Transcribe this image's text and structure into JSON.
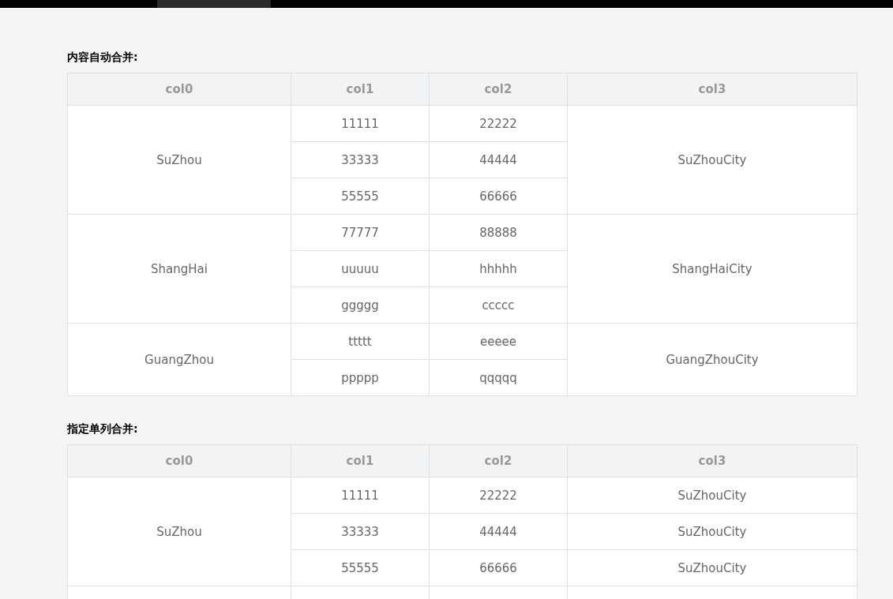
{
  "tables": [
    {
      "title": "内容自动合并:",
      "merge_col3": true,
      "columns": [
        "col0",
        "col1",
        "col2",
        "col3"
      ],
      "groups": [
        {
          "col0": "SuZhou",
          "col3": "SuZhouCity",
          "rows": [
            {
              "col1": "11111",
              "col2": "22222"
            },
            {
              "col1": "33333",
              "col2": "44444"
            },
            {
              "col1": "55555",
              "col2": "66666"
            }
          ]
        },
        {
          "col0": "ShangHai",
          "col3": "ShangHaiCity",
          "rows": [
            {
              "col1": "77777",
              "col2": "88888"
            },
            {
              "col1": "uuuuu",
              "col2": "hhhhh"
            },
            {
              "col1": "ggggg",
              "col2": "ccccc"
            }
          ]
        },
        {
          "col0": "GuangZhou",
          "col3": "GuangZhouCity",
          "rows": [
            {
              "col1": "ttttt",
              "col2": "eeeee"
            },
            {
              "col1": "ppppp",
              "col2": "qqqqq"
            }
          ]
        }
      ]
    },
    {
      "title": "指定单列合并:",
      "merge_col3": false,
      "columns": [
        "col0",
        "col1",
        "col2",
        "col3"
      ],
      "groups": [
        {
          "col0": "SuZhou",
          "rows": [
            {
              "col1": "11111",
              "col2": "22222",
              "col3": "SuZhouCity"
            },
            {
              "col1": "33333",
              "col2": "44444",
              "col3": "SuZhouCity"
            },
            {
              "col1": "55555",
              "col2": "66666",
              "col3": "SuZhouCity"
            }
          ]
        }
      ]
    }
  ]
}
